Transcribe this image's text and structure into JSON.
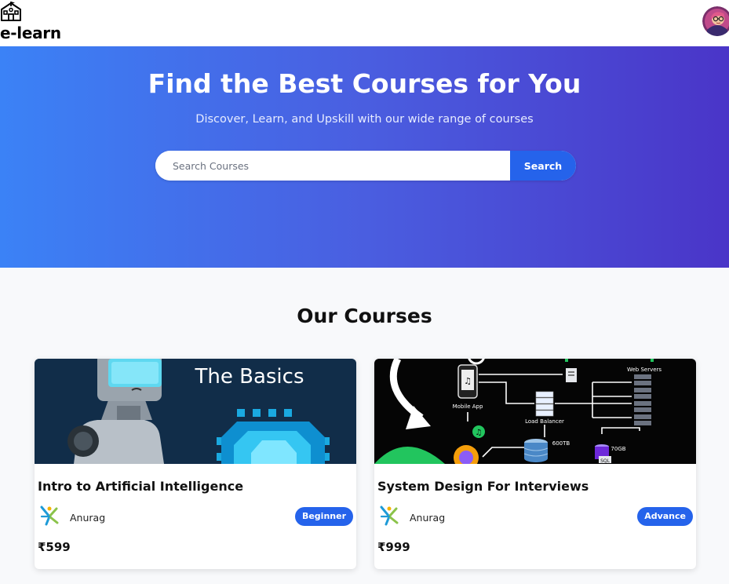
{
  "nav": {
    "brand": "e-learn",
    "logo_icon": "school-building-icon",
    "avatar_icon": "user-avatar"
  },
  "hero": {
    "title": "Find the Best Courses for You",
    "subtitle": "Discover, Learn, and Upskill with our wide range of courses",
    "search_placeholder": "Search Courses",
    "search_button": "Search"
  },
  "section_title": "Our Courses",
  "courses": [
    {
      "banner_text": "The Basics",
      "title": "Intro to Artificial Intelligence",
      "author": "Anurag",
      "level": "Beginner",
      "price": "₹599"
    },
    {
      "banner_labels": [
        "Mobile App",
        "Load Balancer",
        "Web Servers",
        "600TB",
        "70GB",
        "SQL"
      ],
      "title": "System Design For Interviews",
      "author": "Anurag",
      "level": "Advance",
      "price": "₹999"
    }
  ],
  "colors": {
    "accent": "#2563eb",
    "hero_gradient_start": "#3b82f6",
    "hero_gradient_end": "#4a35c8"
  }
}
